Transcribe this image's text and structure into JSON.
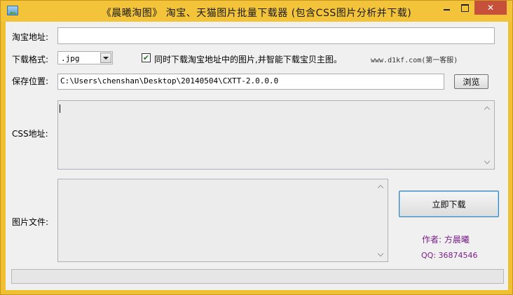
{
  "window": {
    "title": "《晨曦淘图》 淘宝、天猫图片批量下载器 (包含CSS图片分析并下载)",
    "close_glyph": "✕"
  },
  "form": {
    "taobao_label": "淘宝地址:",
    "taobao_value": "",
    "format_label": "下载格式:",
    "format_value": ".jpg",
    "sync_checkbox_checked": true,
    "sync_checkbox_label": "同时下载淘宝地址中的图片,并智能下载宝贝主图。",
    "site_text": "www.d1kf.com(第一客服)",
    "save_label": "保存位置:",
    "save_value": "C:\\Users\\chenshan\\Desktop\\20140504\\CXTT-2.0.0.0",
    "browse_button": "浏览",
    "css_label": "CSS地址:",
    "css_value": "",
    "image_files_label": "图片文件:",
    "image_files_value": "",
    "download_button": "立即下载"
  },
  "author": {
    "name_line": "作者: 方晨曦",
    "qq_line": "QQ: 36874546"
  },
  "colors": {
    "titlebar": "#f3c43a",
    "close_button": "#c7503a",
    "author_text": "#7a1f8a"
  }
}
